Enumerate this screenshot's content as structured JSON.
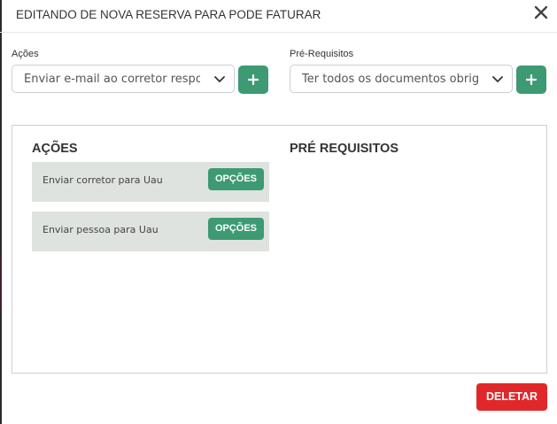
{
  "modal": {
    "title": "EDITANDO DE NOVA RESERVA PARA PODE FATURAR",
    "close_icon": "close-icon"
  },
  "acoes_field": {
    "label": "Ações",
    "selected_value": "Enviar e-mail ao corretor responsável",
    "add_icon": "plus-icon"
  },
  "prereq_field": {
    "label": "Pré-Requisitos",
    "selected_value": "Ter todos os documentos obrigatórios",
    "add_icon": "plus-icon"
  },
  "panel": {
    "actions_heading": "AÇÕES",
    "prereq_heading": "PRÉ REQUISITOS",
    "actions": [
      {
        "label": "Enviar corretor para Uau",
        "options_label": "OPÇÕES"
      },
      {
        "label": "Enviar pessoa para Uau",
        "options_label": "OPÇÕES"
      }
    ]
  },
  "footer": {
    "delete_label": "DELETAR"
  },
  "colors": {
    "accent_green": "#3d9a72",
    "danger_red": "#e0282a",
    "row_background": "#dfe3df"
  }
}
